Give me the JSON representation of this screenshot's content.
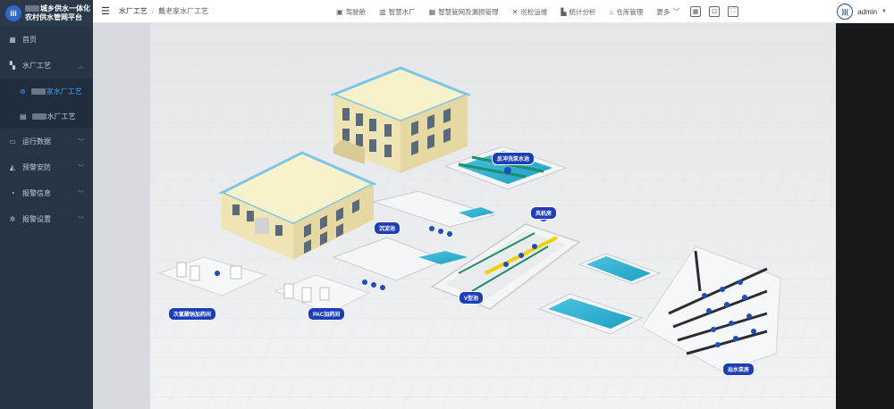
{
  "sidebar": {
    "brand_line1": "城乡供水一体化",
    "brand_line2": "农村供水管网平台",
    "brand_logo": "iii",
    "items": [
      {
        "label": "首页",
        "icon": "dashboard-icon"
      },
      {
        "label": "水厂工艺",
        "icon": "grid-icon",
        "expanded": true,
        "children": [
          {
            "label": "家水厂工艺",
            "icon": "process-icon",
            "active": true
          },
          {
            "label": "水厂工艺",
            "icon": "document-icon",
            "active": false
          }
        ]
      },
      {
        "label": "运行数据",
        "icon": "monitor-icon"
      },
      {
        "label": "预警安防",
        "icon": "alarm-icon"
      },
      {
        "label": "报警信息",
        "icon": "bell-icon"
      },
      {
        "label": "报警设置",
        "icon": "gear-icon"
      }
    ]
  },
  "header": {
    "breadcrumb": [
      "水厂工艺",
      "戴老家水厂工艺"
    ],
    "nav": [
      {
        "label": "驾驶舱",
        "icon": "cockpit-icon"
      },
      {
        "label": "智慧水厂",
        "icon": "factory-icon"
      },
      {
        "label": "智慧管网及漏损管理",
        "icon": "network-icon"
      },
      {
        "label": "巡检运维",
        "icon": "tools-icon"
      },
      {
        "label": "统计分析",
        "icon": "chart-icon"
      },
      {
        "label": "仓库管理",
        "icon": "warehouse-icon"
      },
      {
        "label": "更多",
        "icon": "chevron-down-icon"
      }
    ],
    "user": "admin"
  },
  "scene": {
    "labels": {
      "backwash": "反冲洗泵水池",
      "sedimentation": "沉淀池",
      "blower": "风机房",
      "vfilter": "V型池",
      "chlorine": "次氯酸钠加药间",
      "pac": "PAC加药间",
      "outlet_pump": "出水泵房"
    }
  },
  "colors": {
    "sidebar_bg": "#263445",
    "accent": "#409eff",
    "label_bg": "#1c3fb7",
    "water": "#3fb8d6"
  }
}
